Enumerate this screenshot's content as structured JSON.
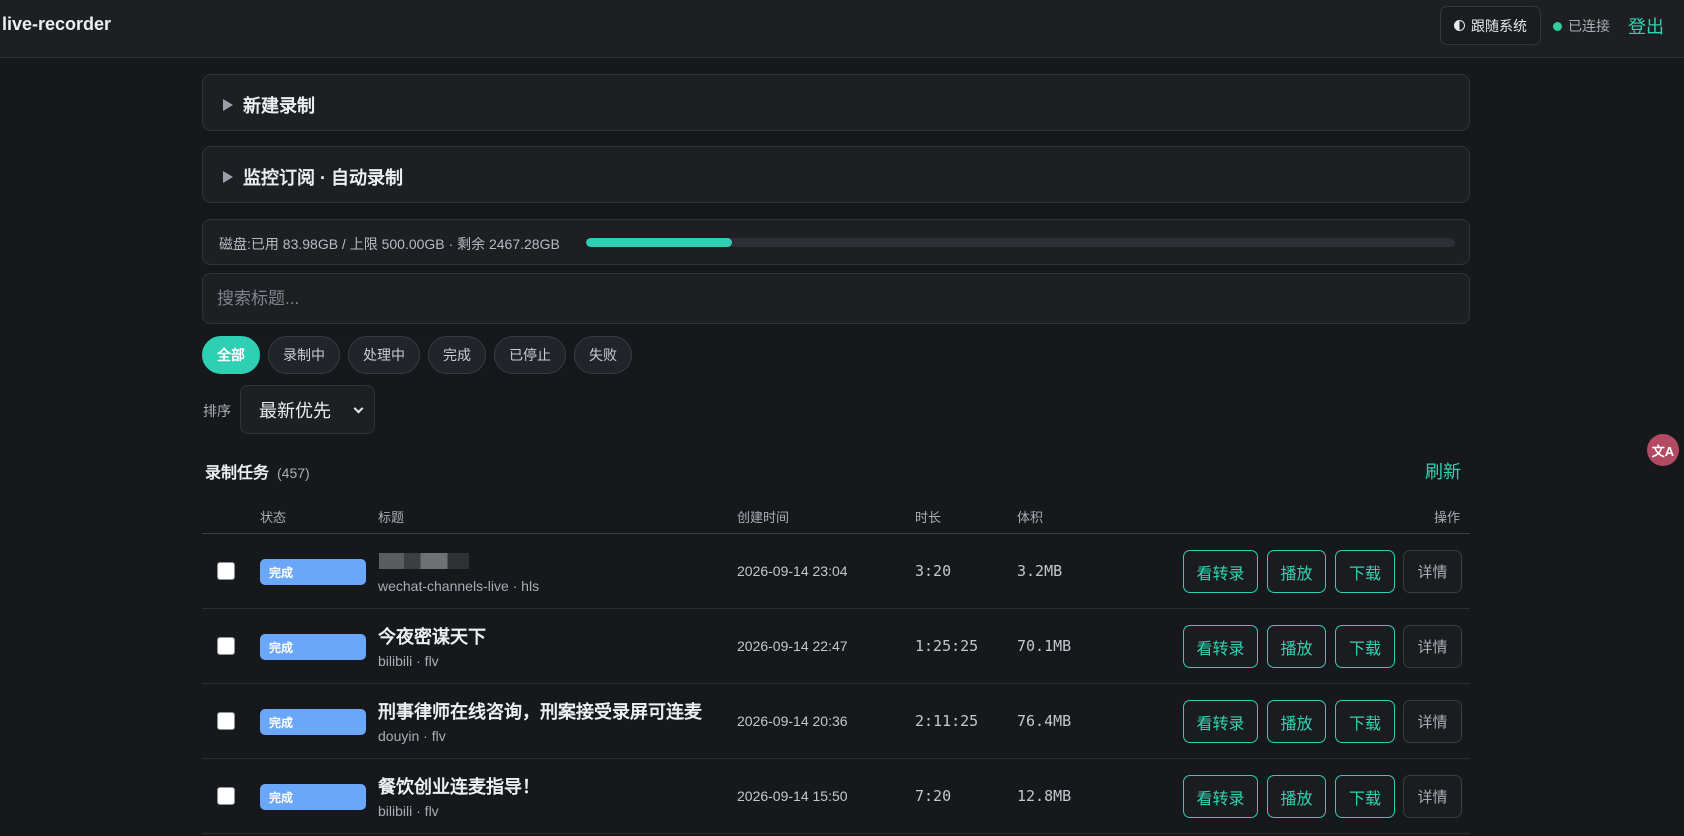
{
  "header": {
    "app_title": "live-recorder",
    "theme_label": "跟随系统",
    "status_label": "已连接",
    "logout_label": "登出"
  },
  "panels": {
    "new_recording": "新建录制",
    "monitor": "监控订阅 · 自动录制"
  },
  "disk": {
    "text": "磁盘:已用 83.98GB / 上限 500.00GB · 剩余 2467.28GB",
    "used_fraction": 0.168
  },
  "search": {
    "placeholder": "搜索标题..."
  },
  "filters": [
    "全部",
    "录制中",
    "处理中",
    "完成",
    "已停止",
    "失败"
  ],
  "active_filter": "全部",
  "sort": {
    "label": "排序",
    "selected": "最新优先"
  },
  "tasks": {
    "title": "录制任务",
    "count": "(457)",
    "refresh_label": "刷新"
  },
  "table": {
    "headers": {
      "status": "状态",
      "title": "标题",
      "created": "创建时间",
      "duration": "时长",
      "size": "体积",
      "actions": "操作"
    },
    "buttons": {
      "transcript": "看转录",
      "play": "播放",
      "download": "下载",
      "details": "详情"
    },
    "rows": [
      {
        "status": "完成",
        "title": "",
        "source": "wechat-channels-live · hls",
        "created": "2026-09-14 23:04",
        "duration": "3:20",
        "size": "3.2MB"
      },
      {
        "status": "完成",
        "title": "今夜密谋天下",
        "source": "bilibili · flv",
        "created": "2026-09-14 22:47",
        "duration": "1:25:25",
        "size": "70.1MB"
      },
      {
        "status": "完成",
        "title": "刑事律师在线咨询，刑案接受录屏可连麦",
        "source": "douyin · flv",
        "created": "2026-09-14 20:36",
        "duration": "2:11:25",
        "size": "76.4MB"
      },
      {
        "status": "完成",
        "title": "餐饮创业连麦指导！",
        "source": "bilibili · flv",
        "created": "2026-09-14 15:50",
        "duration": "7:20",
        "size": "12.8MB"
      }
    ]
  },
  "colors": {
    "accent": "#2ecfb3",
    "badge_done": "#6aa7f8",
    "background": "#16181c"
  },
  "icons": {
    "theme": "half-circle-icon",
    "status": "dot-icon",
    "expand": "triangle-right-icon",
    "translate": "translate-icon"
  }
}
